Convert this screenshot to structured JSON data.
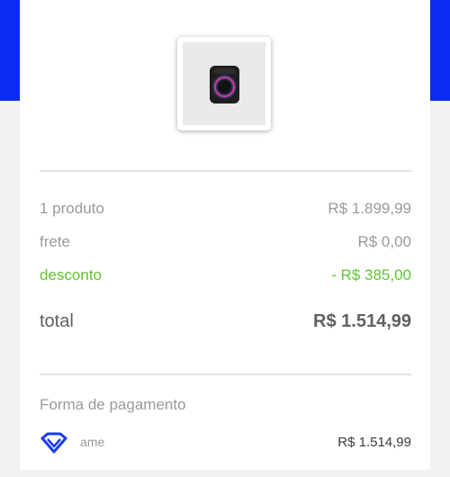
{
  "summary": {
    "products": {
      "label": "1 produto",
      "value": "R$ 1.899,99"
    },
    "shipping": {
      "label": "frete",
      "value": "R$ 0,00"
    },
    "discount": {
      "label": "desconto",
      "value": "- R$ 385,00"
    },
    "total": {
      "label": "total",
      "value": "R$ 1.514,99"
    }
  },
  "payment": {
    "title": "Forma de pagamento",
    "method_icon": "ame-diamond-icon",
    "method_label": "ame",
    "amount": "R$ 1.514,99"
  },
  "colors": {
    "header_blue": "#0a2cf0",
    "discount_green": "#5fc52d",
    "text_gray": "#9a9a9a",
    "ame_blue": "#1a3af0"
  }
}
